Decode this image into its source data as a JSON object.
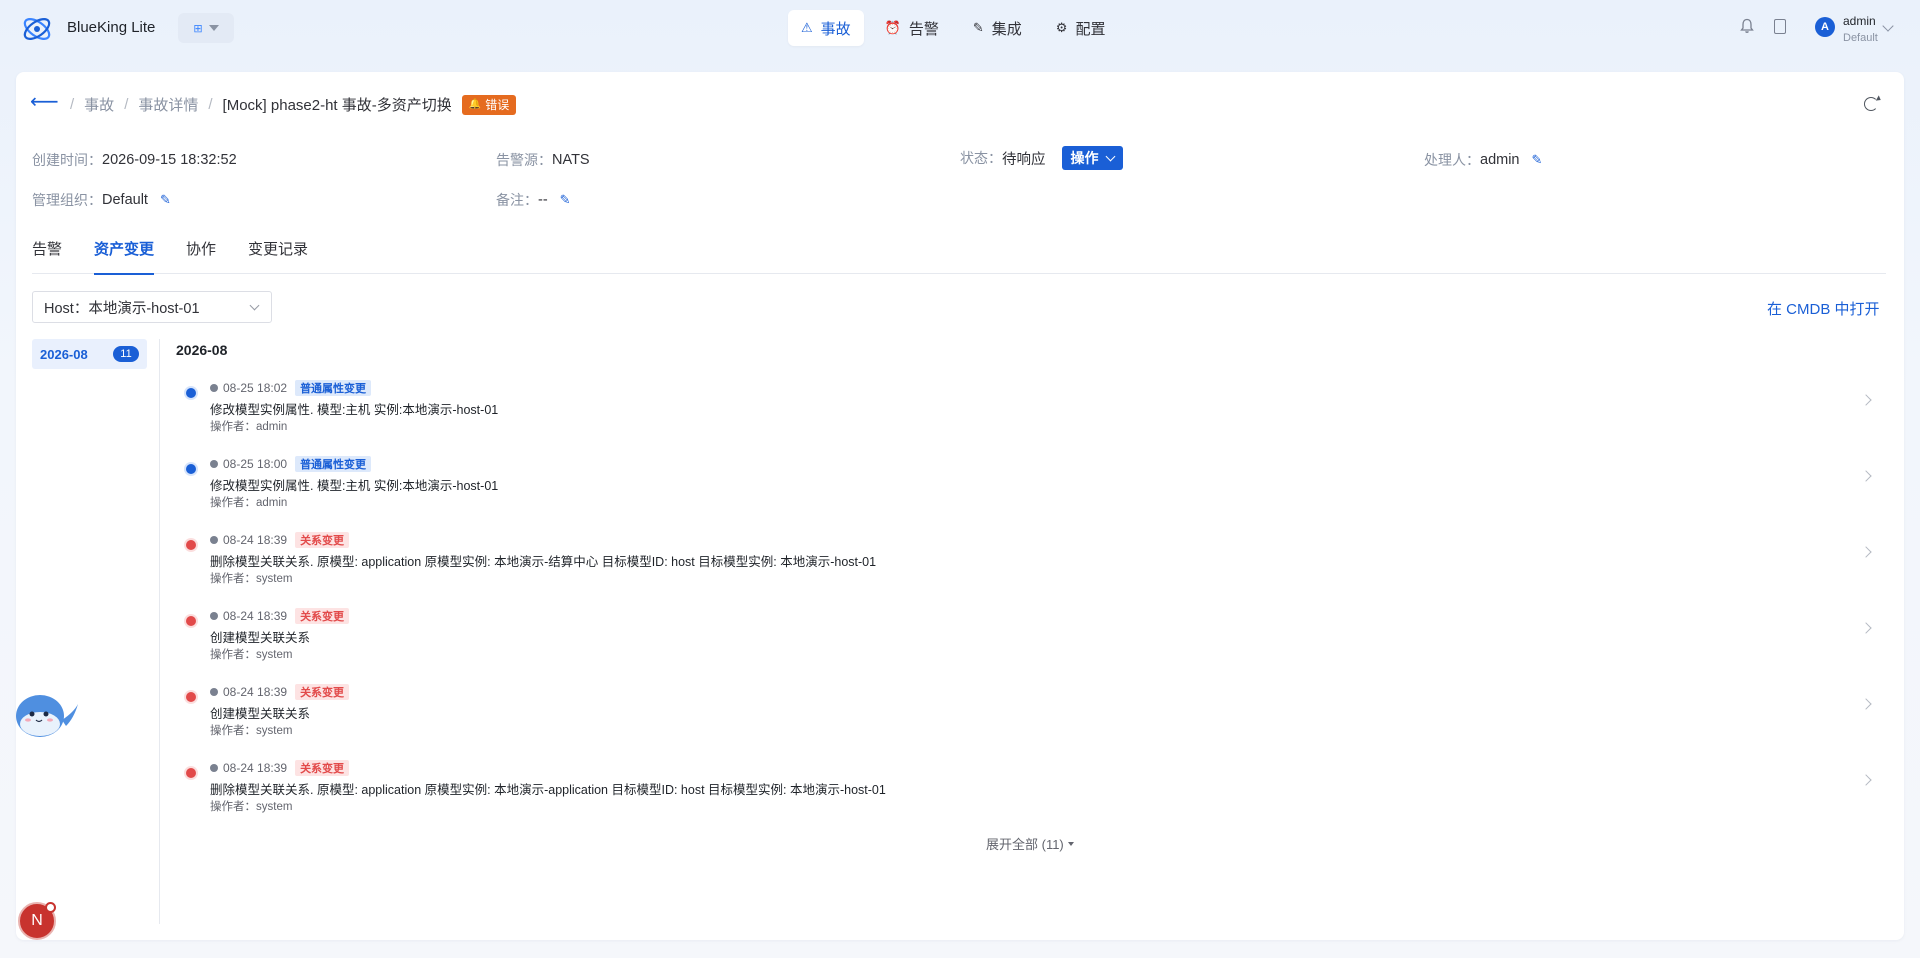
{
  "header": {
    "brand": "BlueKing Lite",
    "nav": [
      {
        "label": "事故",
        "icon": "warning-icon",
        "active": true
      },
      {
        "label": "告警",
        "icon": "alarm-icon",
        "active": false
      },
      {
        "label": "集成",
        "icon": "plug-icon",
        "active": false
      },
      {
        "label": "配置",
        "icon": "gear-icon",
        "active": false
      }
    ],
    "user": {
      "initial": "A",
      "name": "admin",
      "org": "Default"
    }
  },
  "breadcrumb": {
    "items": [
      "事故",
      "事故详情"
    ],
    "current": "[Mock] phase2-ht 事故-多资产切换",
    "badge": "错误"
  },
  "info": {
    "created_label": "创建时间：",
    "created_value": "2026-09-15 18:32:52",
    "source_label": "告警源：",
    "source_value": "NATS",
    "status_label": "状态：",
    "status_value": "待响应",
    "operate_label": "操作",
    "handler_label": "处理人：",
    "handler_value": "admin",
    "org_label": "管理组织：",
    "org_value": "Default",
    "note_label": "备注：",
    "note_value": "--"
  },
  "tabs": [
    {
      "label": "告警",
      "active": false
    },
    {
      "label": "资产变更",
      "active": true
    },
    {
      "label": "协作",
      "active": false
    },
    {
      "label": "变更记录",
      "active": false
    }
  ],
  "filter": {
    "host_select": "Host：本地演示-host-01",
    "cmdb_link": "在 CMDB 中打开"
  },
  "timeline": {
    "month": "2026-08",
    "month_count": "11",
    "month_title": "2026-08",
    "entries": [
      {
        "time": "08-25 18:02",
        "tag": "普通属性变更",
        "tag_type": "blue",
        "dot_color": "#1a5fd6",
        "desc": "修改模型实例属性. 模型:主机 实例:本地演示-host-01",
        "operator": "操作者：admin"
      },
      {
        "time": "08-25 18:00",
        "tag": "普通属性变更",
        "tag_type": "blue",
        "dot_color": "#1a5fd6",
        "desc": "修改模型实例属性. 模型:主机 实例:本地演示-host-01",
        "operator": "操作者：admin"
      },
      {
        "time": "08-24 18:39",
        "tag": "关系变更",
        "tag_type": "red",
        "dot_color": "#e24a4a",
        "desc": "删除模型关联关系. 原模型: application 原模型实例: 本地演示-结算中心 目标模型ID: host 目标模型实例: 本地演示-host-01",
        "operator": "操作者：system"
      },
      {
        "time": "08-24 18:39",
        "tag": "关系变更",
        "tag_type": "red",
        "dot_color": "#e24a4a",
        "desc": "创建模型关联关系",
        "operator": "操作者：system"
      },
      {
        "time": "08-24 18:39",
        "tag": "关系变更",
        "tag_type": "red",
        "dot_color": "#e24a4a",
        "desc": "创建模型关联关系",
        "operator": "操作者：system"
      },
      {
        "time": "08-24 18:39",
        "tag": "关系变更",
        "tag_type": "red",
        "dot_color": "#e24a4a",
        "desc": "删除模型关联关系. 原模型: application 原模型实例: 本地演示-application 目标模型ID: host 目标模型实例: 本地演示-host-01",
        "operator": "操作者：system"
      }
    ],
    "expand_all": "展开全部 (11)"
  },
  "floating": {
    "n_badge": "N"
  }
}
